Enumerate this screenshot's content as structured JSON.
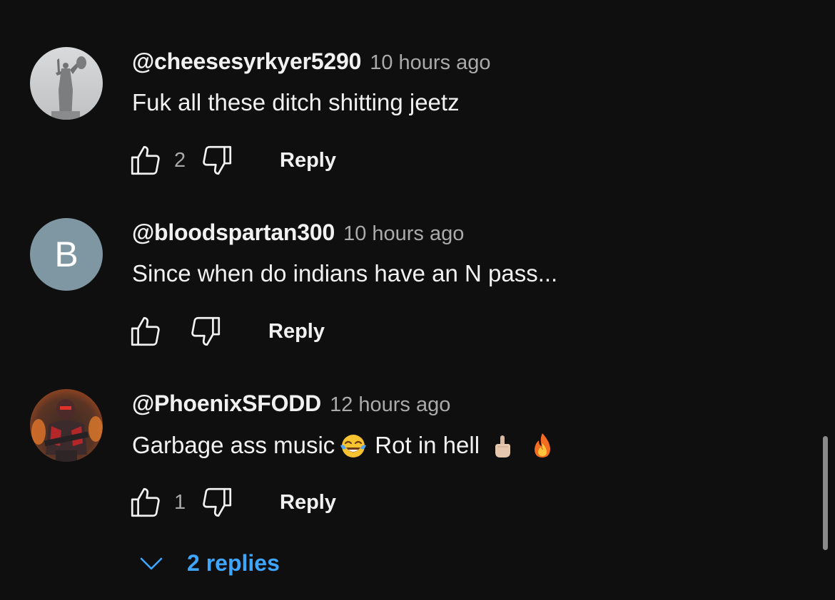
{
  "comments": [
    {
      "author": "@cheesesyrkyer5290",
      "time": "10 hours ago",
      "text": "Fuk all these ditch shitting jeetz",
      "likes": "2",
      "reply_label": "Reply",
      "avatar": "statue-photo"
    },
    {
      "author": "@bloodspartan300",
      "time": "10 hours ago",
      "text": "Since when do indians have an N pass...",
      "likes": "",
      "reply_label": "Reply",
      "avatar_letter": "B",
      "avatar_color": "#7f97a2"
    },
    {
      "author": "@PhoenixSFODD",
      "time": "12 hours ago",
      "text_part1": "Garbage ass music",
      "text_part2": "Rot in hell",
      "emojis": [
        "face-with-tears-of-joy",
        "middle-finger",
        "fire"
      ],
      "likes": "1",
      "reply_label": "Reply",
      "avatar": "red-armored-soldier"
    }
  ],
  "replies_toggle": {
    "label": "2 replies"
  },
  "colors": {
    "background": "#0f0f0f",
    "primary_text": "#f1f1f1",
    "secondary_text": "#aaaaaa",
    "link": "#3ea6ff"
  }
}
